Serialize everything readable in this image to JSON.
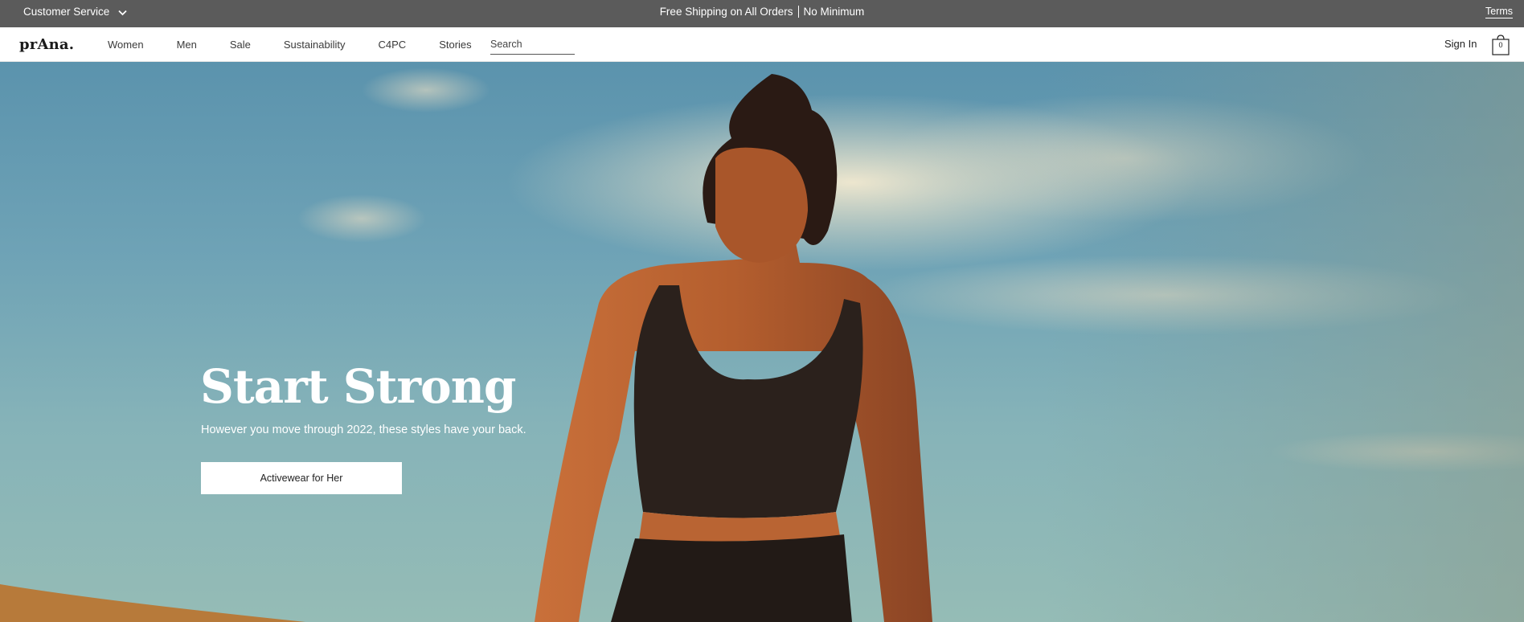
{
  "promo": {
    "customer_service_label": "Customer Service",
    "shipping_left": "Free Shipping on All Orders",
    "shipping_right": "No Minimum",
    "terms_label": "Terms"
  },
  "header": {
    "logo": "prAna",
    "logo_dot": ".",
    "nav": [
      "Women",
      "Men",
      "Sale",
      "Sustainability",
      "C4PC",
      "Stories"
    ],
    "search_placeholder": "Search",
    "sign_in_label": "Sign In",
    "cart_count": "0"
  },
  "hero": {
    "title": "Start Strong",
    "subtitle": "However you move through 2022, these styles have your back.",
    "cta_label": "Activewear for Her"
  },
  "icons": {
    "customer_service": "chevron-down-icon",
    "cart": "shopping-bag-icon"
  },
  "colors": {
    "promo_bar": "#5b5b5b",
    "sky": "#6fa3b6",
    "header_bg": "#ffffff"
  }
}
